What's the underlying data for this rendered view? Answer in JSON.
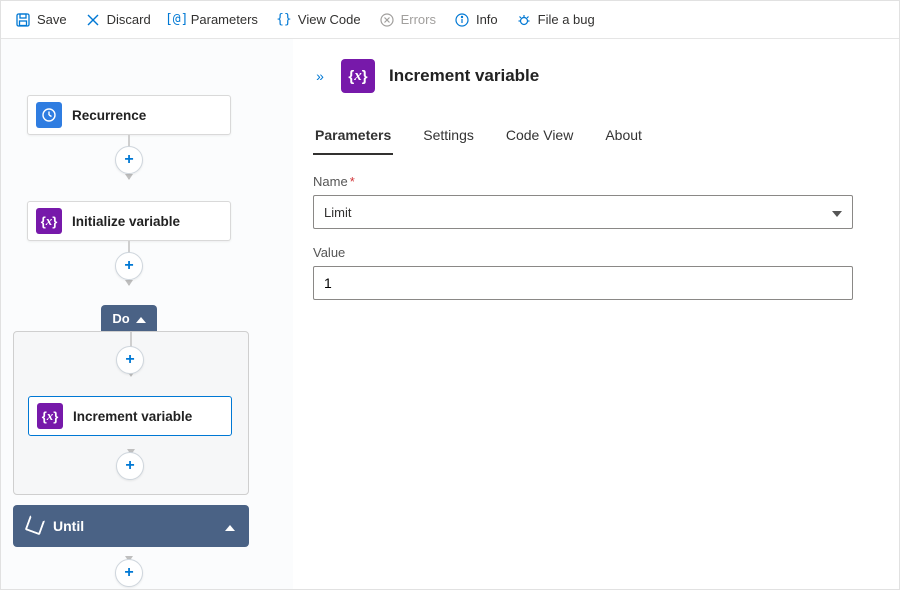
{
  "toolbar": {
    "save": "Save",
    "discard": "Discard",
    "parameters": "Parameters",
    "viewcode": "View Code",
    "errors": "Errors",
    "info": "Info",
    "fileabug": "File a bug"
  },
  "flow": {
    "recurrence_label": "Recurrence",
    "initialize_label": "Initialize variable",
    "do_label": "Do",
    "increment_label": "Increment variable",
    "until_label": "Until"
  },
  "details": {
    "title": "Increment variable",
    "tabs": {
      "parameters": "Parameters",
      "settings": "Settings",
      "codeview": "Code View",
      "about": "About"
    },
    "form": {
      "name_label": "Name",
      "name_value": "Limit",
      "value_label": "Value",
      "value_value": "1"
    }
  }
}
